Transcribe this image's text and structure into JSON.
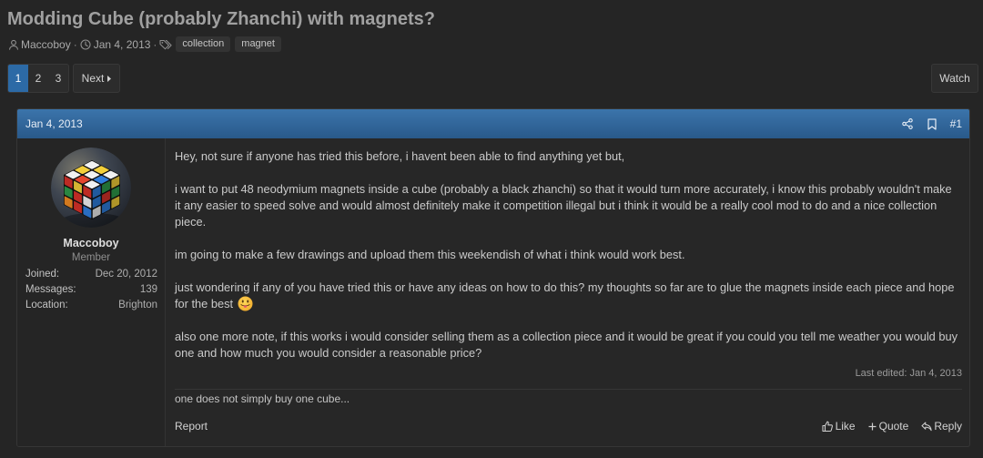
{
  "thread": {
    "title": "Modding Cube (probably Zhanchi) with magnets?",
    "author": "Maccoboy",
    "separator": "·",
    "date": "Jan 4, 2013",
    "tags": [
      "collection",
      "magnet"
    ]
  },
  "pagination": {
    "pages": [
      "1",
      "2",
      "3"
    ],
    "current_page": 1,
    "next_label": "Next"
  },
  "watch_label": "Watch",
  "post": {
    "date": "Jan 4, 2013",
    "number": "#1",
    "user": {
      "name": "Maccoboy",
      "title": "Member",
      "stats": [
        {
          "label": "Joined:",
          "value": "Dec 20, 2012"
        },
        {
          "label": "Messages:",
          "value": "139"
        },
        {
          "label": "Location:",
          "value": "Brighton"
        }
      ]
    },
    "body": [
      [
        "Hey, not sure if anyone has tried this before, i havent been able to find anything yet but,"
      ],
      [
        "i want to put 48 neodymium magnets inside a cube (probably a black zhanchi) so that it would turn more accurately, i know this probably wouldn't make",
        "it any easier to speed solve and would almost definitely make it competition illegal but i think it would be a really cool mod to do and a nice collection",
        "piece."
      ],
      [
        "im going to make a few drawings and upload them this weekendish of what i think would work best."
      ],
      [
        "just wondering if any of you have tried this or have any ideas on how to do this? my thoughts so far are to glue the magnets inside each piece and hope",
        "for the best"
      ],
      [
        "also one more note, if this works i would consider selling them as a collection piece and it would be great if you could you tell me weather you would buy",
        "one and how much you would consider a reasonable price?"
      ]
    ],
    "last_edited": "Last edited: Jan 4, 2013",
    "signature": "one does not simply buy one cube...",
    "actions": {
      "report": "Report",
      "like": "Like",
      "quote": "Quote",
      "reply": "Reply"
    }
  },
  "icons": {
    "author": "user-icon",
    "date": "clock-icon",
    "tags": "tag-icon",
    "next": "caret-right-icon",
    "share": "share-icon",
    "bookmark": "bookmark-icon",
    "like": "thumbs-up-icon",
    "quote": "plus-icon",
    "reply": "reply-icon",
    "emoji": "face-with-tongue-emoji"
  },
  "colors": {
    "accent": "#2c6aa6",
    "header_top": "#3b74ab",
    "header_bottom": "#29598a",
    "page_bg": "#252525",
    "text": "#cacaca"
  }
}
